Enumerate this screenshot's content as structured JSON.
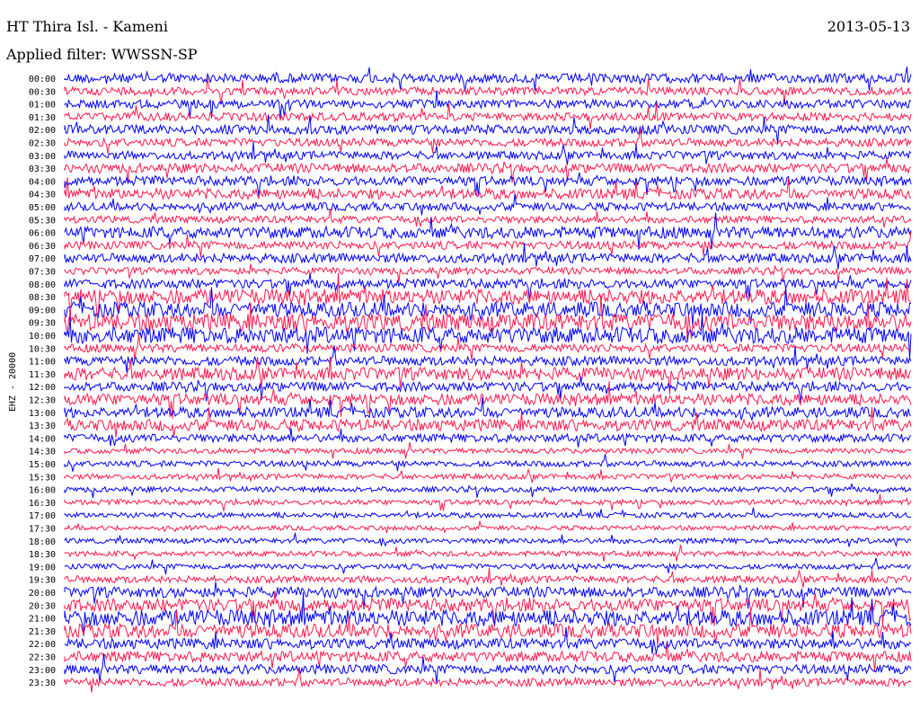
{
  "header": {
    "station": "HT Thira Isl. - Kameni",
    "date": "2013-05-13",
    "filter": "Applied filter: WWSSN-SP"
  },
  "colors": {
    "trace_a": "#0000ff",
    "trace_b": "#ff1a4d",
    "background": "#ffffff"
  },
  "chart_data": {
    "type": "helicorder",
    "ylabel": "EHZ - 20000",
    "row_labels": [
      "00:00",
      "00:30",
      "01:00",
      "01:30",
      "02:00",
      "02:30",
      "03:00",
      "03:30",
      "04:00",
      "04:30",
      "05:00",
      "05:30",
      "06:00",
      "06:30",
      "07:00",
      "07:30",
      "08:00",
      "08:30",
      "09:00",
      "09:30",
      "10:00",
      "10:30",
      "11:00",
      "11:30",
      "12:00",
      "12:30",
      "13:00",
      "13:30",
      "14:00",
      "14:30",
      "15:00",
      "15:30",
      "16:00",
      "16:30",
      "17:00",
      "17:30",
      "18:00",
      "18:30",
      "19:00",
      "19:30",
      "20:00",
      "20:30",
      "21:00",
      "21:30",
      "22:00",
      "22:30",
      "23:00",
      "23:30"
    ],
    "row_colors": [
      "trace_a",
      "trace_b"
    ],
    "relative_amplitude": [
      1.6,
      1.4,
      1.5,
      1.4,
      1.6,
      1.4,
      1.4,
      1.6,
      1.6,
      1.8,
      1.4,
      1.2,
      2.0,
      1.4,
      1.6,
      1.2,
      1.6,
      2.6,
      2.6,
      3.0,
      2.8,
      1.4,
      1.6,
      2.2,
      1.6,
      2.0,
      1.8,
      2.0,
      1.4,
      0.9,
      1.0,
      0.9,
      0.9,
      0.9,
      0.9,
      0.8,
      0.9,
      0.9,
      0.9,
      1.2,
      1.8,
      2.2,
      2.8,
      2.4,
      1.8,
      1.8,
      1.6,
      1.4
    ]
  }
}
